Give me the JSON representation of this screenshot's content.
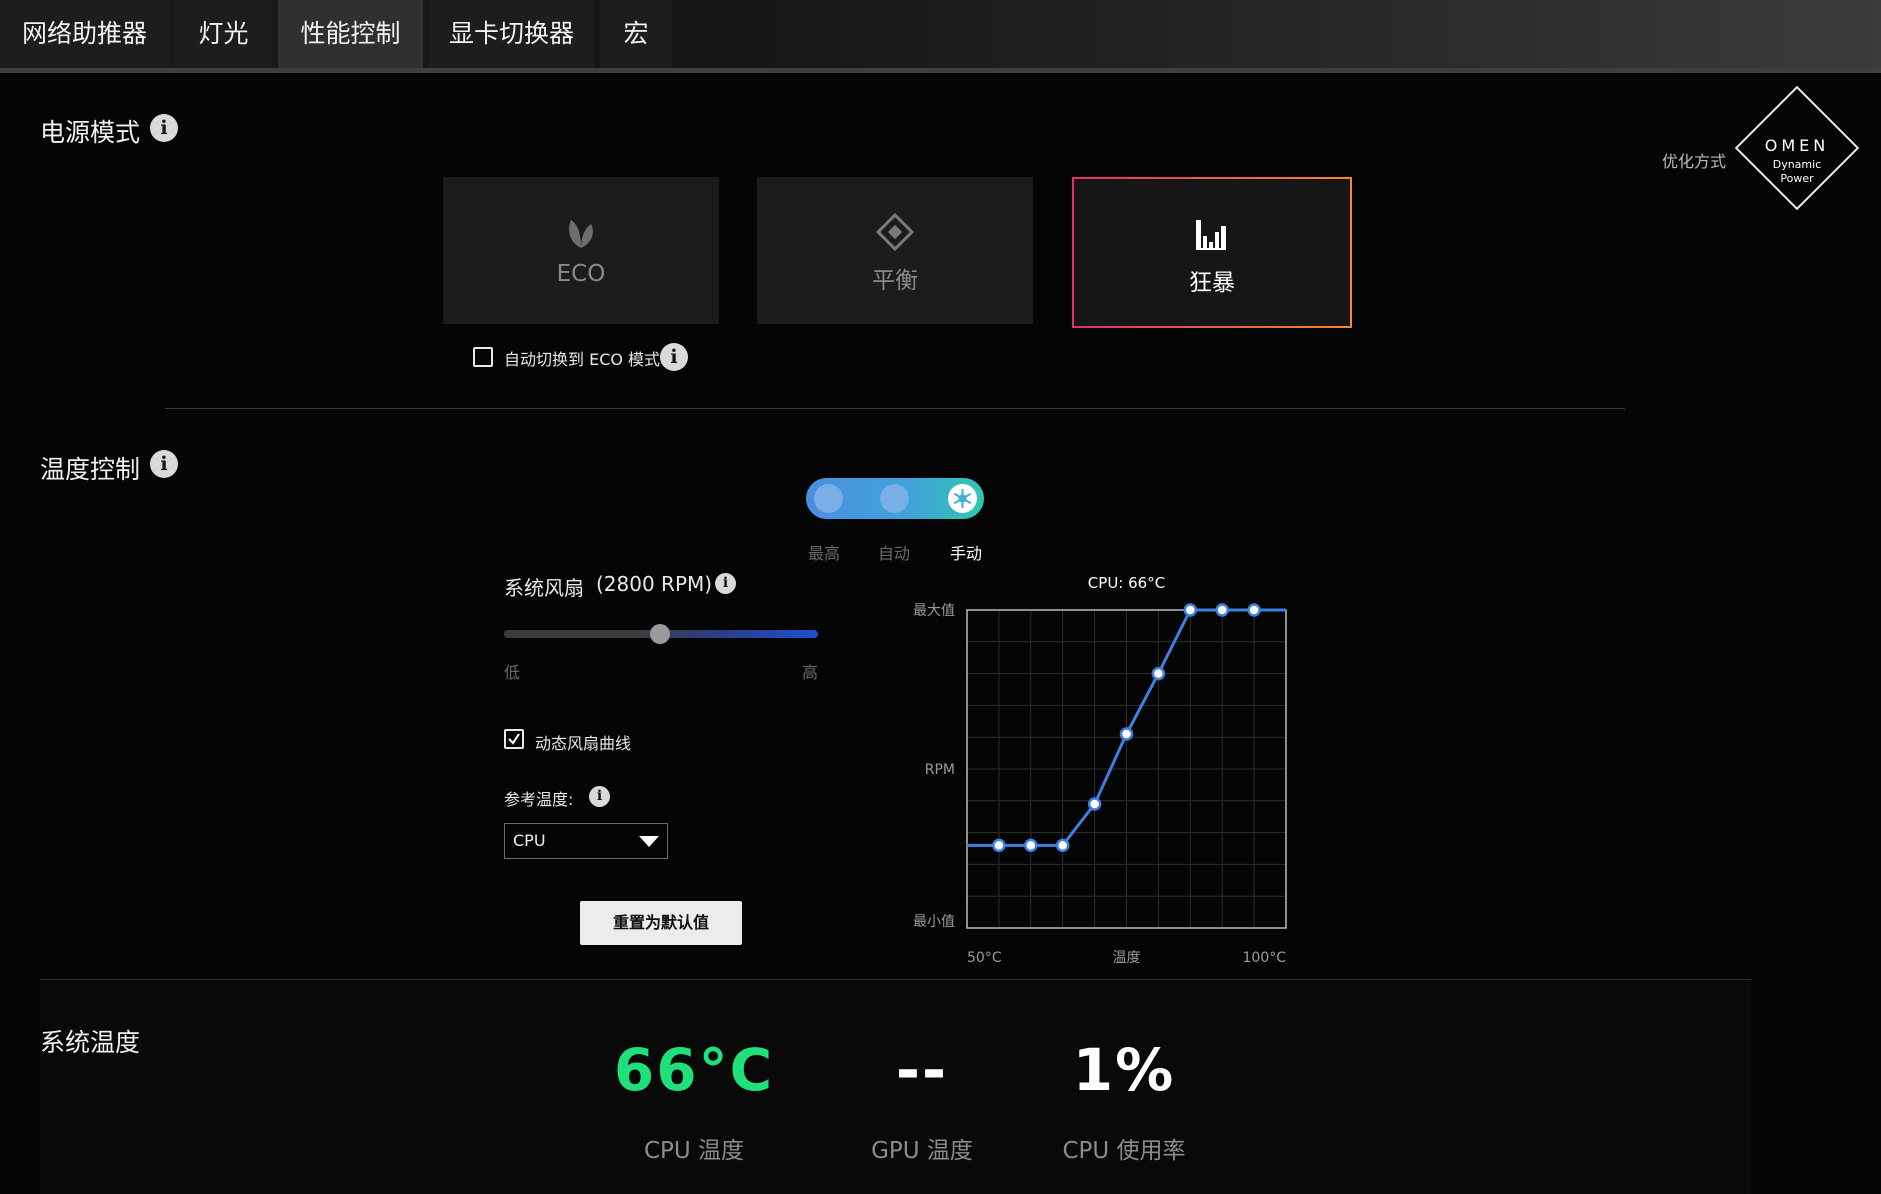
{
  "tabs": [
    {
      "label": "网络助推器",
      "active": false
    },
    {
      "label": "灯光",
      "active": false
    },
    {
      "label": "性能控制",
      "active": true
    },
    {
      "label": "显卡切换器",
      "active": false
    },
    {
      "label": "宏",
      "active": false
    }
  ],
  "power_mode": {
    "title": "电源模式",
    "modes": [
      {
        "label": "ECO",
        "icon": "leaf-icon",
        "active": false
      },
      {
        "label": "平衡",
        "icon": "diamond-icon",
        "active": false
      },
      {
        "label": "狂暴",
        "icon": "bars-icon",
        "active": true
      }
    ],
    "auto_eco_label": "自动切换到 ECO 模式",
    "auto_eco_checked": false
  },
  "omen_badge": {
    "prefix": "优化方式",
    "brand": "OMEN",
    "line1": "Dynamic",
    "line2": "Power"
  },
  "temperature_control": {
    "title": "温度控制",
    "fan_modes": [
      "最高",
      "自动",
      "手动"
    ],
    "fan_mode_selected": "手动",
    "system_fan_label": "系统风扇",
    "system_fan_rpm": "(2800 RPM)",
    "slider_low": "低",
    "slider_high": "高",
    "slider_value_fraction": 0.5,
    "dynamic_curve_label": "动态风扇曲线",
    "dynamic_curve_checked": true,
    "ref_temp_label": "参考温度:",
    "ref_temp_value": "CPU",
    "reset_button": "重置为默认值"
  },
  "chart_data": {
    "type": "line",
    "title": "CPU: 66°C",
    "xlabel": "温度",
    "ylabel": "RPM",
    "x_tick_labels": [
      "50°C",
      "100°C"
    ],
    "y_tick_labels": [
      "最大值",
      "最小值"
    ],
    "xlim": [
      50,
      100
    ],
    "ylim": [
      0,
      1
    ],
    "grid": true,
    "series": [
      {
        "x": [
          50,
          55,
          60,
          65,
          70,
          75,
          80,
          85,
          90,
          95,
          100
        ],
        "y": [
          0.26,
          0.26,
          0.26,
          0.26,
          0.39,
          0.61,
          0.8,
          1.0,
          1.0,
          1.0,
          1.0
        ],
        "markers": [
          false,
          true,
          true,
          true,
          true,
          true,
          true,
          true,
          true,
          true,
          false
        ],
        "color": "#3f7fe0"
      }
    ]
  },
  "system_temperature": {
    "title": "系统温度",
    "cpu_temp": "66°C",
    "cpu_temp_label": "CPU 温度",
    "gpu_temp": "--",
    "gpu_temp_label": "GPU 温度",
    "cpu_usage": "1%",
    "cpu_usage_label": "CPU 使用率",
    "cpu_temp_color": "#1fe07a"
  }
}
